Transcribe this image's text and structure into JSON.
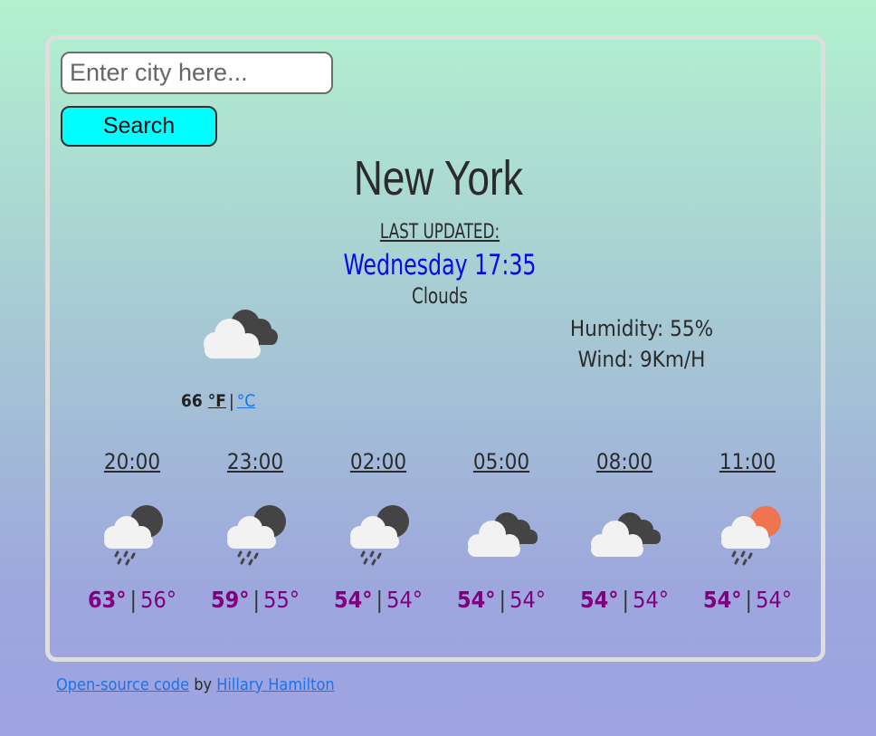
{
  "search": {
    "placeholder": "Enter city here...",
    "value": "",
    "button_label": "Search"
  },
  "weather": {
    "city": "New York",
    "last_updated_label": "LAST UPDATED:",
    "date_time": "Wednesday 17:35",
    "description": "Clouds",
    "main_icon": "broken-clouds-icon",
    "temperature": "66",
    "unit_f": "°F",
    "unit_separator": "|",
    "unit_c": "°C",
    "humidity": "Humidity: 55%",
    "wind": "Wind: 9Km/H"
  },
  "forecast": [
    {
      "time": "20:00",
      "icon": "rain-cloud-moon-icon",
      "max": "63°",
      "sep": "|",
      "min": "56°"
    },
    {
      "time": "23:00",
      "icon": "rain-cloud-moon-icon",
      "max": "59°",
      "sep": "|",
      "min": "55°"
    },
    {
      "time": "02:00",
      "icon": "rain-cloud-moon-icon",
      "max": "54°",
      "sep": "|",
      "min": "54°"
    },
    {
      "time": "05:00",
      "icon": "broken-clouds-icon",
      "max": "54°",
      "sep": "|",
      "min": "54°"
    },
    {
      "time": "08:00",
      "icon": "broken-clouds-icon",
      "max": "54°",
      "sep": "|",
      "min": "54°"
    },
    {
      "time": "11:00",
      "icon": "rain-cloud-sun-icon",
      "max": "54°",
      "sep": "|",
      "min": "54°"
    }
  ],
  "footer": {
    "code_link": "Open-source code",
    "by": "by",
    "author_link": "Hillary Hamilton"
  },
  "colors": {
    "search_button": "#00ffff",
    "date_time": "#0a07e8",
    "forecast_temp": "#800080",
    "link": "#1a73e8"
  }
}
